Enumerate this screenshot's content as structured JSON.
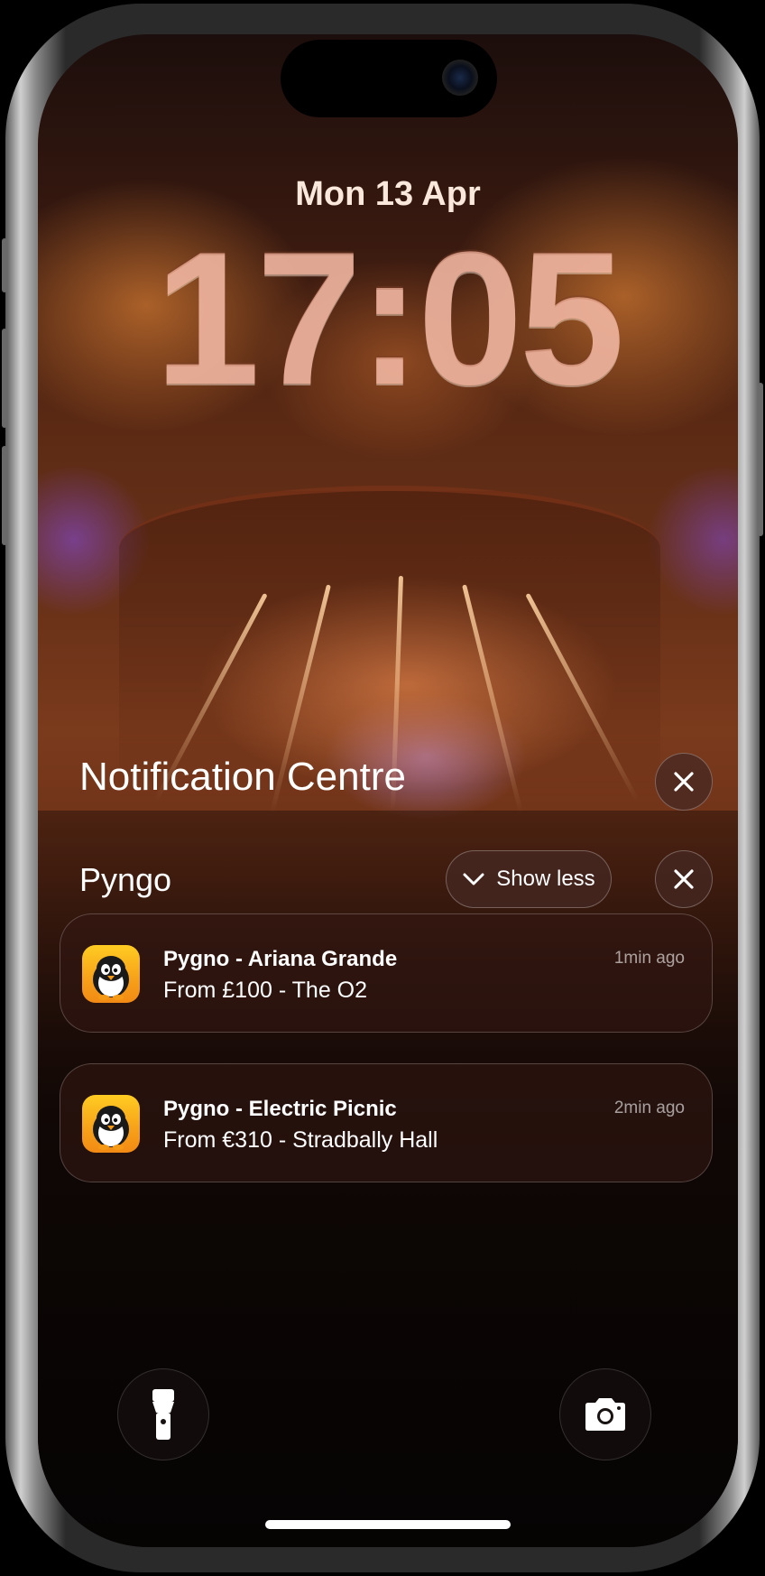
{
  "lockscreen": {
    "date": "Mon 13 Apr",
    "time": "17:05"
  },
  "notification_centre": {
    "title": "Notification Centre",
    "close_icon": "close-icon"
  },
  "group": {
    "app_name": "Pyngo",
    "show_less_label": "Show less",
    "chevron_icon": "chevron-down-icon",
    "close_icon": "close-icon"
  },
  "notifications": [
    {
      "app_icon": "penguin-app-icon",
      "title": "Pygno - Ariana Grande",
      "body": "From £100 - The O2",
      "time": "1min ago"
    },
    {
      "app_icon": "penguin-app-icon",
      "title": "Pygno - Electric Picnic",
      "body": "From €310 - Stradbally Hall",
      "time": "2min ago"
    }
  ],
  "quick_actions": {
    "left_icon": "flashlight-icon",
    "right_icon": "camera-icon"
  },
  "colors": {
    "clock_tint": "#f6b6a0",
    "app_icon_orange": "#f7a01a"
  }
}
